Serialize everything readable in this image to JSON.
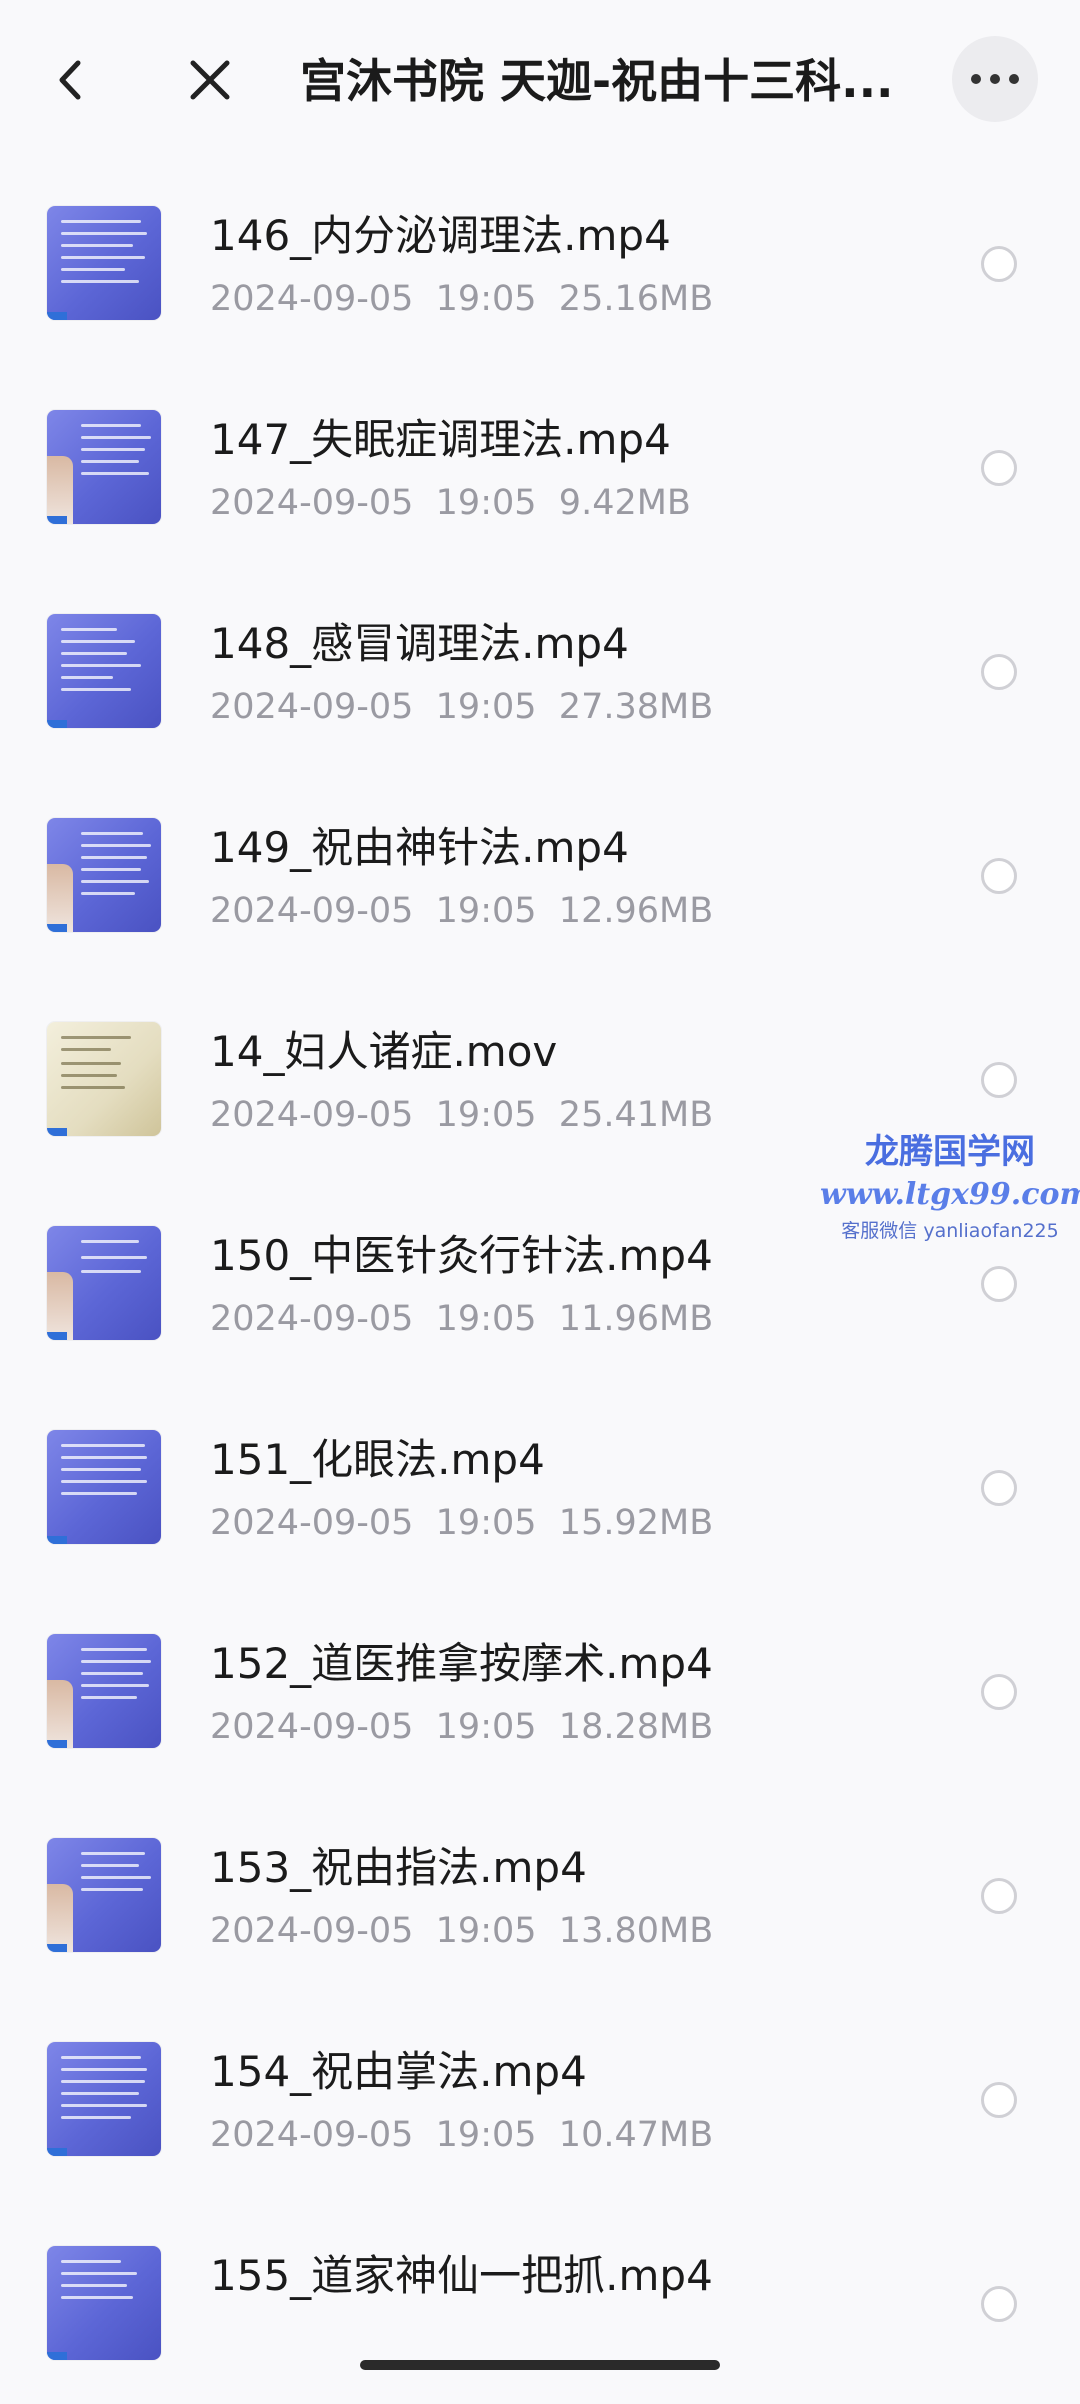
{
  "header": {
    "title": "宫沐书院 天迦-祝由十三科...",
    "back_icon": "chevron-left-icon",
    "close_icon": "close-icon",
    "more_icon": "more-horizontal-icon"
  },
  "files": [
    {
      "name": "146_内分泌调理法.mp4",
      "date": "2024-09-05  19:05",
      "size": "25.16MB",
      "thumb": "video-slide-blue"
    },
    {
      "name": "147_失眠症调理法.mp4",
      "date": "2024-09-05  19:05",
      "size": "9.42MB",
      "thumb": "video-slide-blue"
    },
    {
      "name": "148_感冒调理法.mp4",
      "date": "2024-09-05  19:05",
      "size": "27.38MB",
      "thumb": "video-slide-blue"
    },
    {
      "name": "149_祝由神针法.mp4",
      "date": "2024-09-05  19:05",
      "size": "12.96MB",
      "thumb": "video-slide-blue"
    },
    {
      "name": "14_妇人诸症.mov",
      "date": "2024-09-05  19:05",
      "size": "25.41MB",
      "thumb": "video-slide-beige"
    },
    {
      "name": "150_中医针灸行针法.mp4",
      "date": "2024-09-05  19:05",
      "size": "11.96MB",
      "thumb": "video-slide-blue"
    },
    {
      "name": "151_化眼法.mp4",
      "date": "2024-09-05  19:05",
      "size": "15.92MB",
      "thumb": "video-slide-blue"
    },
    {
      "name": "152_道医推拿按摩术.mp4",
      "date": "2024-09-05  19:05",
      "size": "18.28MB",
      "thumb": "video-slide-blue"
    },
    {
      "name": "153_祝由指法.mp4",
      "date": "2024-09-05  19:05",
      "size": "13.80MB",
      "thumb": "video-slide-blue"
    },
    {
      "name": "154_祝由掌法.mp4",
      "date": "2024-09-05  19:05",
      "size": "10.47MB",
      "thumb": "video-slide-blue"
    },
    {
      "name": "155_道家神仙一把抓.mp4",
      "date": "",
      "size": "",
      "thumb": "video-slide-blue"
    }
  ],
  "watermark": {
    "line1": "龙腾国学网",
    "line2": "www.ltgx99.com",
    "line3": "客服微信 yanliaofan225"
  }
}
